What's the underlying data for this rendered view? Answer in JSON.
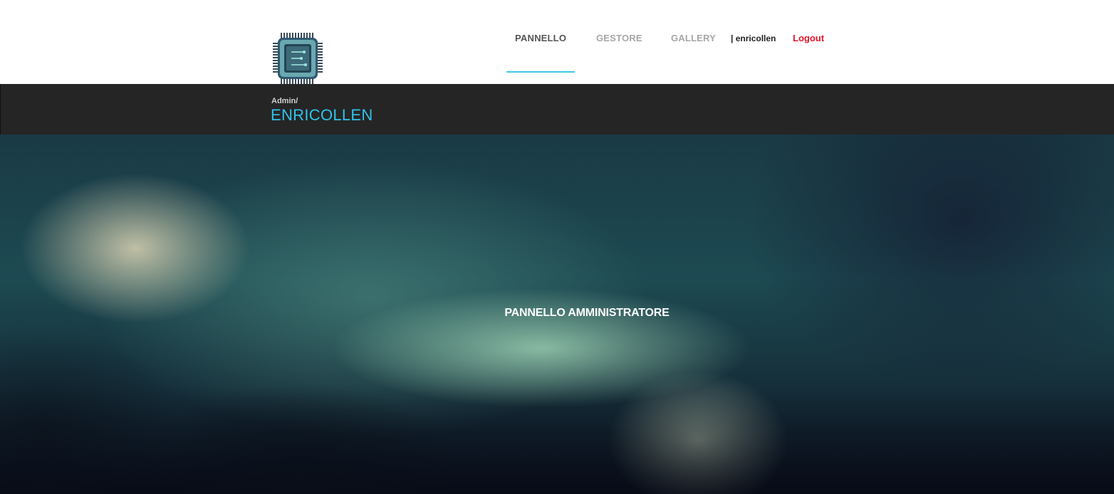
{
  "header": {
    "logo_icon": "cpu-chip-icon",
    "nav": {
      "items": [
        {
          "label": "PANNELLO",
          "active": true
        },
        {
          "label": "GESTORE",
          "active": false
        },
        {
          "label": "GALLERY",
          "active": false
        }
      ],
      "user_label": "| enricollen",
      "logout_label": "Logout"
    }
  },
  "title_bar": {
    "breadcrumb": "Admin/",
    "title": "ENRICOLLEN"
  },
  "hero": {
    "title": "PANNELLO AMMINISTRATORE"
  },
  "colors": {
    "accent": "#2fc3ea",
    "logout": "#e0142b",
    "title_bar_bg": "#252525",
    "nav_inactive": "#a7a7a7",
    "nav_active": "#555555"
  }
}
